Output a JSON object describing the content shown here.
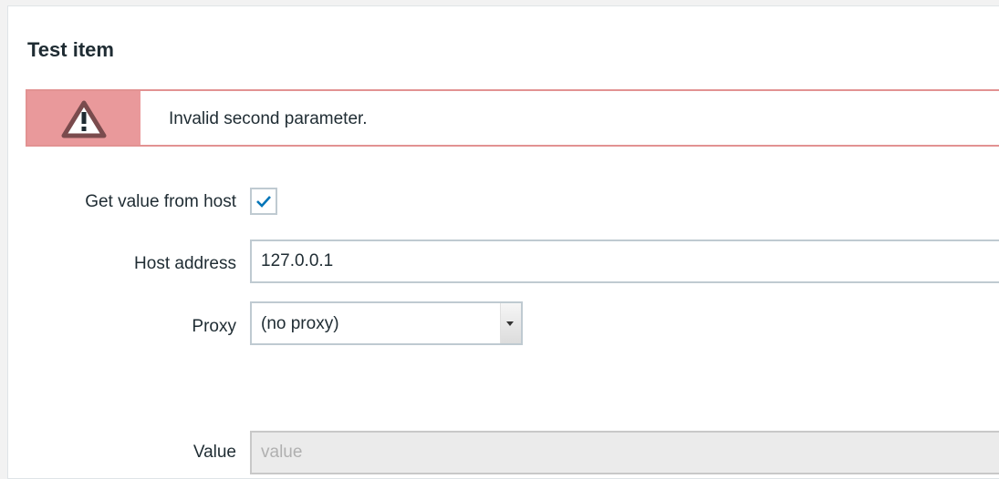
{
  "dialog": {
    "title": "Test item"
  },
  "message": {
    "type": "error",
    "icon": "warning-icon",
    "text": "Invalid second parameter.",
    "colors": {
      "border": "#e29292",
      "icon_bg": "#e9999b"
    }
  },
  "form": {
    "get_value_from_host": {
      "label": "Get value from host",
      "checked": true
    },
    "host_address": {
      "label": "Host address",
      "value": "127.0.0.1"
    },
    "proxy": {
      "label": "Proxy",
      "selected": "(no proxy)"
    },
    "value": {
      "label": "Value",
      "placeholder": "value",
      "value": ""
    }
  },
  "colors": {
    "checkmark": "#0275b8",
    "text": "#1f2c33",
    "field_border": "#bfcad1"
  }
}
